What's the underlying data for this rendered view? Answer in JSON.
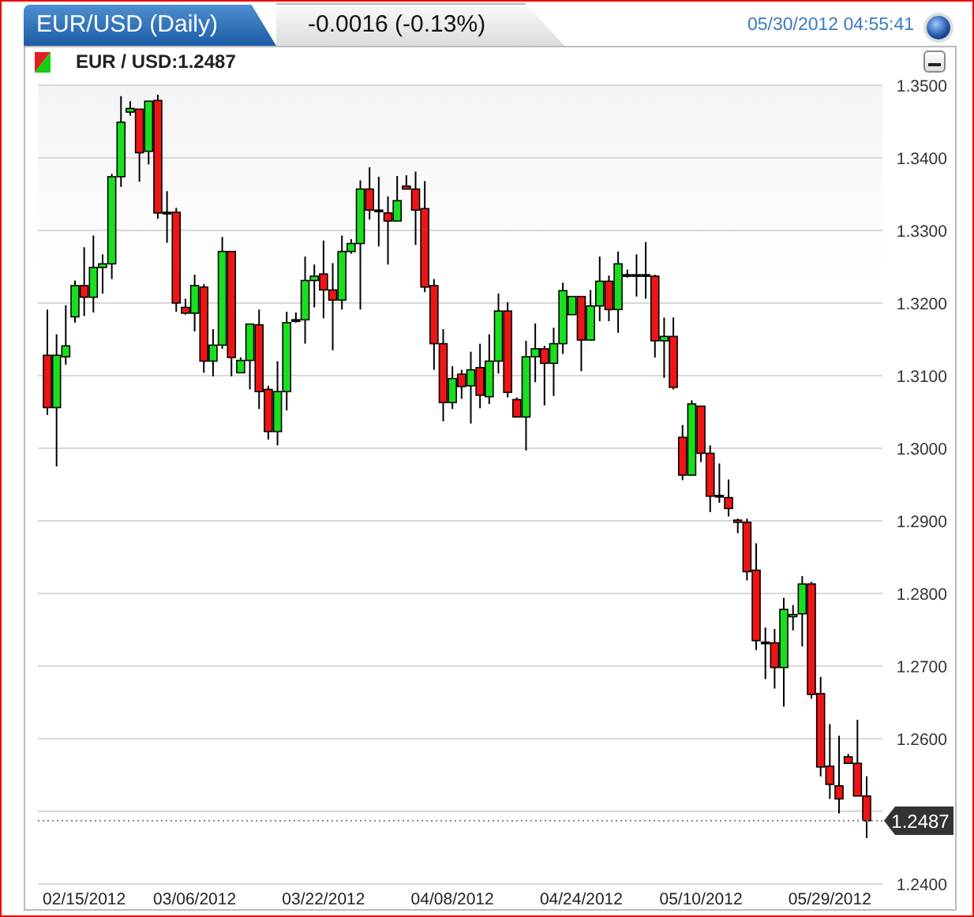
{
  "header": {
    "tab_title": "EUR/USD (Daily)",
    "change": "-0.0016 (-0.13%)",
    "timestamp": "05/30/2012 04:55:41"
  },
  "instrument": {
    "label": "EUR / USD:1.2487"
  },
  "chart": {
    "chart_data": {
      "type": "candlestick",
      "categories": [
        null,
        null,
        null,
        null,
        "02/15/2012",
        null,
        null,
        null,
        null,
        null,
        null,
        null,
        null,
        null,
        null,
        null,
        "03/06/2012",
        null,
        null,
        null,
        null,
        null,
        null,
        null,
        null,
        null,
        null,
        null,
        null,
        null,
        "03/22/2012",
        null,
        null,
        null,
        null,
        null,
        null,
        null,
        null,
        null,
        null,
        null,
        null,
        null,
        "04/08/2012",
        null,
        null,
        null,
        null,
        null,
        null,
        null,
        null,
        null,
        null,
        null,
        null,
        null,
        "04/24/2012",
        null,
        null,
        null,
        null,
        null,
        null,
        null,
        null,
        null,
        null,
        null,
        null,
        "05/10/2012",
        null,
        null,
        null,
        null,
        null,
        null,
        null,
        null,
        null,
        null,
        null,
        null,
        null,
        "05/29/2012",
        null,
        null,
        null,
        null
      ],
      "ohlc": [
        [
          1.3128,
          1.3191,
          1.3046,
          1.3056
        ],
        [
          1.3056,
          1.3157,
          1.2975,
          1.3128
        ],
        [
          1.3126,
          1.3197,
          1.3115,
          1.3141
        ],
        [
          1.3181,
          1.3231,
          1.3173,
          1.3224
        ],
        [
          1.3224,
          1.3277,
          1.3182,
          1.3208
        ],
        [
          1.3208,
          1.3293,
          1.3187,
          1.3249
        ],
        [
          1.3249,
          1.3267,
          1.3213,
          1.3254
        ],
        [
          1.3254,
          1.3378,
          1.3233,
          1.3374
        ],
        [
          1.3374,
          1.3485,
          1.336,
          1.3449
        ],
        [
          1.3463,
          1.3478,
          1.3458,
          1.3468
        ],
        [
          1.3467,
          1.3467,
          1.3367,
          1.3407
        ],
        [
          1.3409,
          1.3478,
          1.3391,
          1.3478
        ],
        [
          1.3479,
          1.3487,
          1.3316,
          1.3324
        ],
        [
          1.3325,
          1.3354,
          1.3283,
          1.3325
        ],
        [
          1.3325,
          1.3331,
          1.3188,
          1.32
        ],
        [
          1.3194,
          1.3206,
          1.3184,
          1.3186
        ],
        [
          1.3186,
          1.3239,
          1.3161,
          1.3224
        ],
        [
          1.3222,
          1.3226,
          1.3104,
          1.312
        ],
        [
          1.312,
          1.3164,
          1.3099,
          1.3142
        ],
        [
          1.3142,
          1.3291,
          1.3137,
          1.3271
        ],
        [
          1.3271,
          1.3271,
          1.3099,
          1.3125
        ],
        [
          1.3104,
          1.3125,
          1.3104,
          1.3121
        ],
        [
          1.3121,
          1.3171,
          1.3081,
          1.3171
        ],
        [
          1.317,
          1.3191,
          1.3054,
          1.3078
        ],
        [
          1.3081,
          1.3086,
          1.3012,
          1.3023
        ],
        [
          1.3023,
          1.312,
          1.3004,
          1.3078
        ],
        [
          1.3078,
          1.3188,
          1.3052,
          1.3173
        ],
        [
          1.3177,
          1.3187,
          1.3173,
          1.3177
        ],
        [
          1.3177,
          1.3264,
          1.3144,
          1.3231
        ],
        [
          1.3231,
          1.3253,
          1.3194,
          1.3237
        ],
        [
          1.324,
          1.3286,
          1.3179,
          1.3218
        ],
        [
          1.3218,
          1.3255,
          1.3135,
          1.3204
        ],
        [
          1.3204,
          1.3293,
          1.3191,
          1.3271
        ],
        [
          1.3271,
          1.3288,
          1.3268,
          1.3282
        ],
        [
          1.3282,
          1.3369,
          1.3191,
          1.3357
        ],
        [
          1.3357,
          1.3387,
          1.3315,
          1.3328
        ],
        [
          1.3328,
          1.3374,
          1.3278,
          1.3328
        ],
        [
          1.3324,
          1.3347,
          1.3253,
          1.3313
        ],
        [
          1.3313,
          1.3375,
          1.3313,
          1.3341
        ],
        [
          1.3361,
          1.3376,
          1.3357,
          1.3357
        ],
        [
          1.3357,
          1.3381,
          1.328,
          1.3328
        ],
        [
          1.333,
          1.3368,
          1.3215,
          1.3222
        ],
        [
          1.3224,
          1.3233,
          1.3108,
          1.3144
        ],
        [
          1.3144,
          1.3164,
          1.3037,
          1.3063
        ],
        [
          1.3063,
          1.3113,
          1.3054,
          1.3096
        ],
        [
          1.3102,
          1.3108,
          1.3068,
          1.3085
        ],
        [
          1.3086,
          1.3133,
          1.3034,
          1.3108
        ],
        [
          1.3111,
          1.3144,
          1.3055,
          1.3073
        ],
        [
          1.3071,
          1.3157,
          1.3061,
          1.312
        ],
        [
          1.312,
          1.3213,
          1.3103,
          1.3189
        ],
        [
          1.3189,
          1.3201,
          1.307,
          1.3077
        ],
        [
          1.3067,
          1.307,
          1.3043,
          1.3043
        ],
        [
          1.3043,
          1.3148,
          1.2997,
          1.3126
        ],
        [
          1.3126,
          1.3172,
          1.3091,
          1.3137
        ],
        [
          1.3137,
          1.3141,
          1.3059,
          1.3117
        ],
        [
          1.3117,
          1.3166,
          1.3072,
          1.3144
        ],
        [
          1.3144,
          1.3228,
          1.313,
          1.3217
        ],
        [
          1.3184,
          1.3209,
          1.3184,
          1.3209
        ],
        [
          1.3209,
          1.3209,
          1.3106,
          1.3149
        ],
        [
          1.3149,
          1.3218,
          1.3149,
          1.3196
        ],
        [
          1.3196,
          1.3264,
          1.3175,
          1.323
        ],
        [
          1.323,
          1.3238,
          1.3175,
          1.3191
        ],
        [
          1.3191,
          1.3271,
          1.3159,
          1.3254
        ],
        [
          1.3239,
          1.3246,
          1.3235,
          1.3239
        ],
        [
          1.3239,
          1.3267,
          1.3209,
          1.3239
        ],
        [
          1.3239,
          1.3284,
          1.3206,
          1.3239
        ],
        [
          1.3237,
          1.3239,
          1.3125,
          1.3148
        ],
        [
          1.3148,
          1.318,
          1.3097,
          1.3154
        ],
        [
          1.3154,
          1.318,
          1.3081,
          1.3084
        ],
        [
          1.3015,
          1.3032,
          1.2956,
          1.2963
        ],
        [
          1.2963,
          1.3066,
          1.2963,
          1.3061
        ],
        [
          1.3058,
          1.3058,
          1.2981,
          1.2993
        ],
        [
          1.2993,
          1.3004,
          1.2912,
          1.2934
        ],
        [
          1.2935,
          1.2979,
          1.2925,
          1.2935
        ],
        [
          1.2932,
          1.2957,
          1.2906,
          1.2917
        ],
        [
          1.2901,
          1.2903,
          1.2883,
          1.2898
        ],
        [
          1.2898,
          1.2903,
          1.2818,
          1.283
        ],
        [
          1.2832,
          1.2869,
          1.2722,
          1.2735
        ],
        [
          1.2733,
          1.2753,
          1.2682,
          1.2733
        ],
        [
          1.2732,
          1.2751,
          1.2669,
          1.2698
        ],
        [
          1.2698,
          1.2794,
          1.2644,
          1.2778
        ],
        [
          1.2768,
          1.2784,
          1.2749,
          1.2771
        ],
        [
          1.2772,
          1.2824,
          1.2727,
          1.2813
        ],
        [
          1.2813,
          1.2816,
          1.2655,
          1.2661
        ],
        [
          1.2662,
          1.2685,
          1.2548,
          1.2561
        ],
        [
          1.2562,
          1.262,
          1.2517,
          1.2537
        ],
        [
          1.2535,
          1.2604,
          1.2497,
          1.2517
        ],
        [
          1.2575,
          1.2579,
          1.2566,
          1.2566
        ],
        [
          1.2566,
          1.2626,
          1.2521,
          1.2521
        ],
        [
          1.2521,
          1.2548,
          1.2463,
          1.2487
        ]
      ],
      "ylim": [
        1.24,
        1.35
      ],
      "yticks": [
        {
          "value": 1.24,
          "label": "1.2400"
        },
        {
          "value": 1.26,
          "label": "1.2600"
        },
        {
          "value": 1.27,
          "label": "1.2700"
        },
        {
          "value": 1.28,
          "label": "1.2800"
        },
        {
          "value": 1.29,
          "label": "1.2900"
        },
        {
          "value": 1.3,
          "label": "1.3000"
        },
        {
          "value": 1.31,
          "label": "1.3100"
        },
        {
          "value": 1.32,
          "label": "1.3200"
        },
        {
          "value": 1.33,
          "label": "1.3300"
        },
        {
          "value": 1.34,
          "label": "1.3400"
        },
        {
          "value": 1.35,
          "label": "1.3500"
        }
      ],
      "grid": true,
      "ref_lines": [
        {
          "axis": "y",
          "value": 1.2487,
          "label": "1.2487"
        }
      ]
    }
  }
}
